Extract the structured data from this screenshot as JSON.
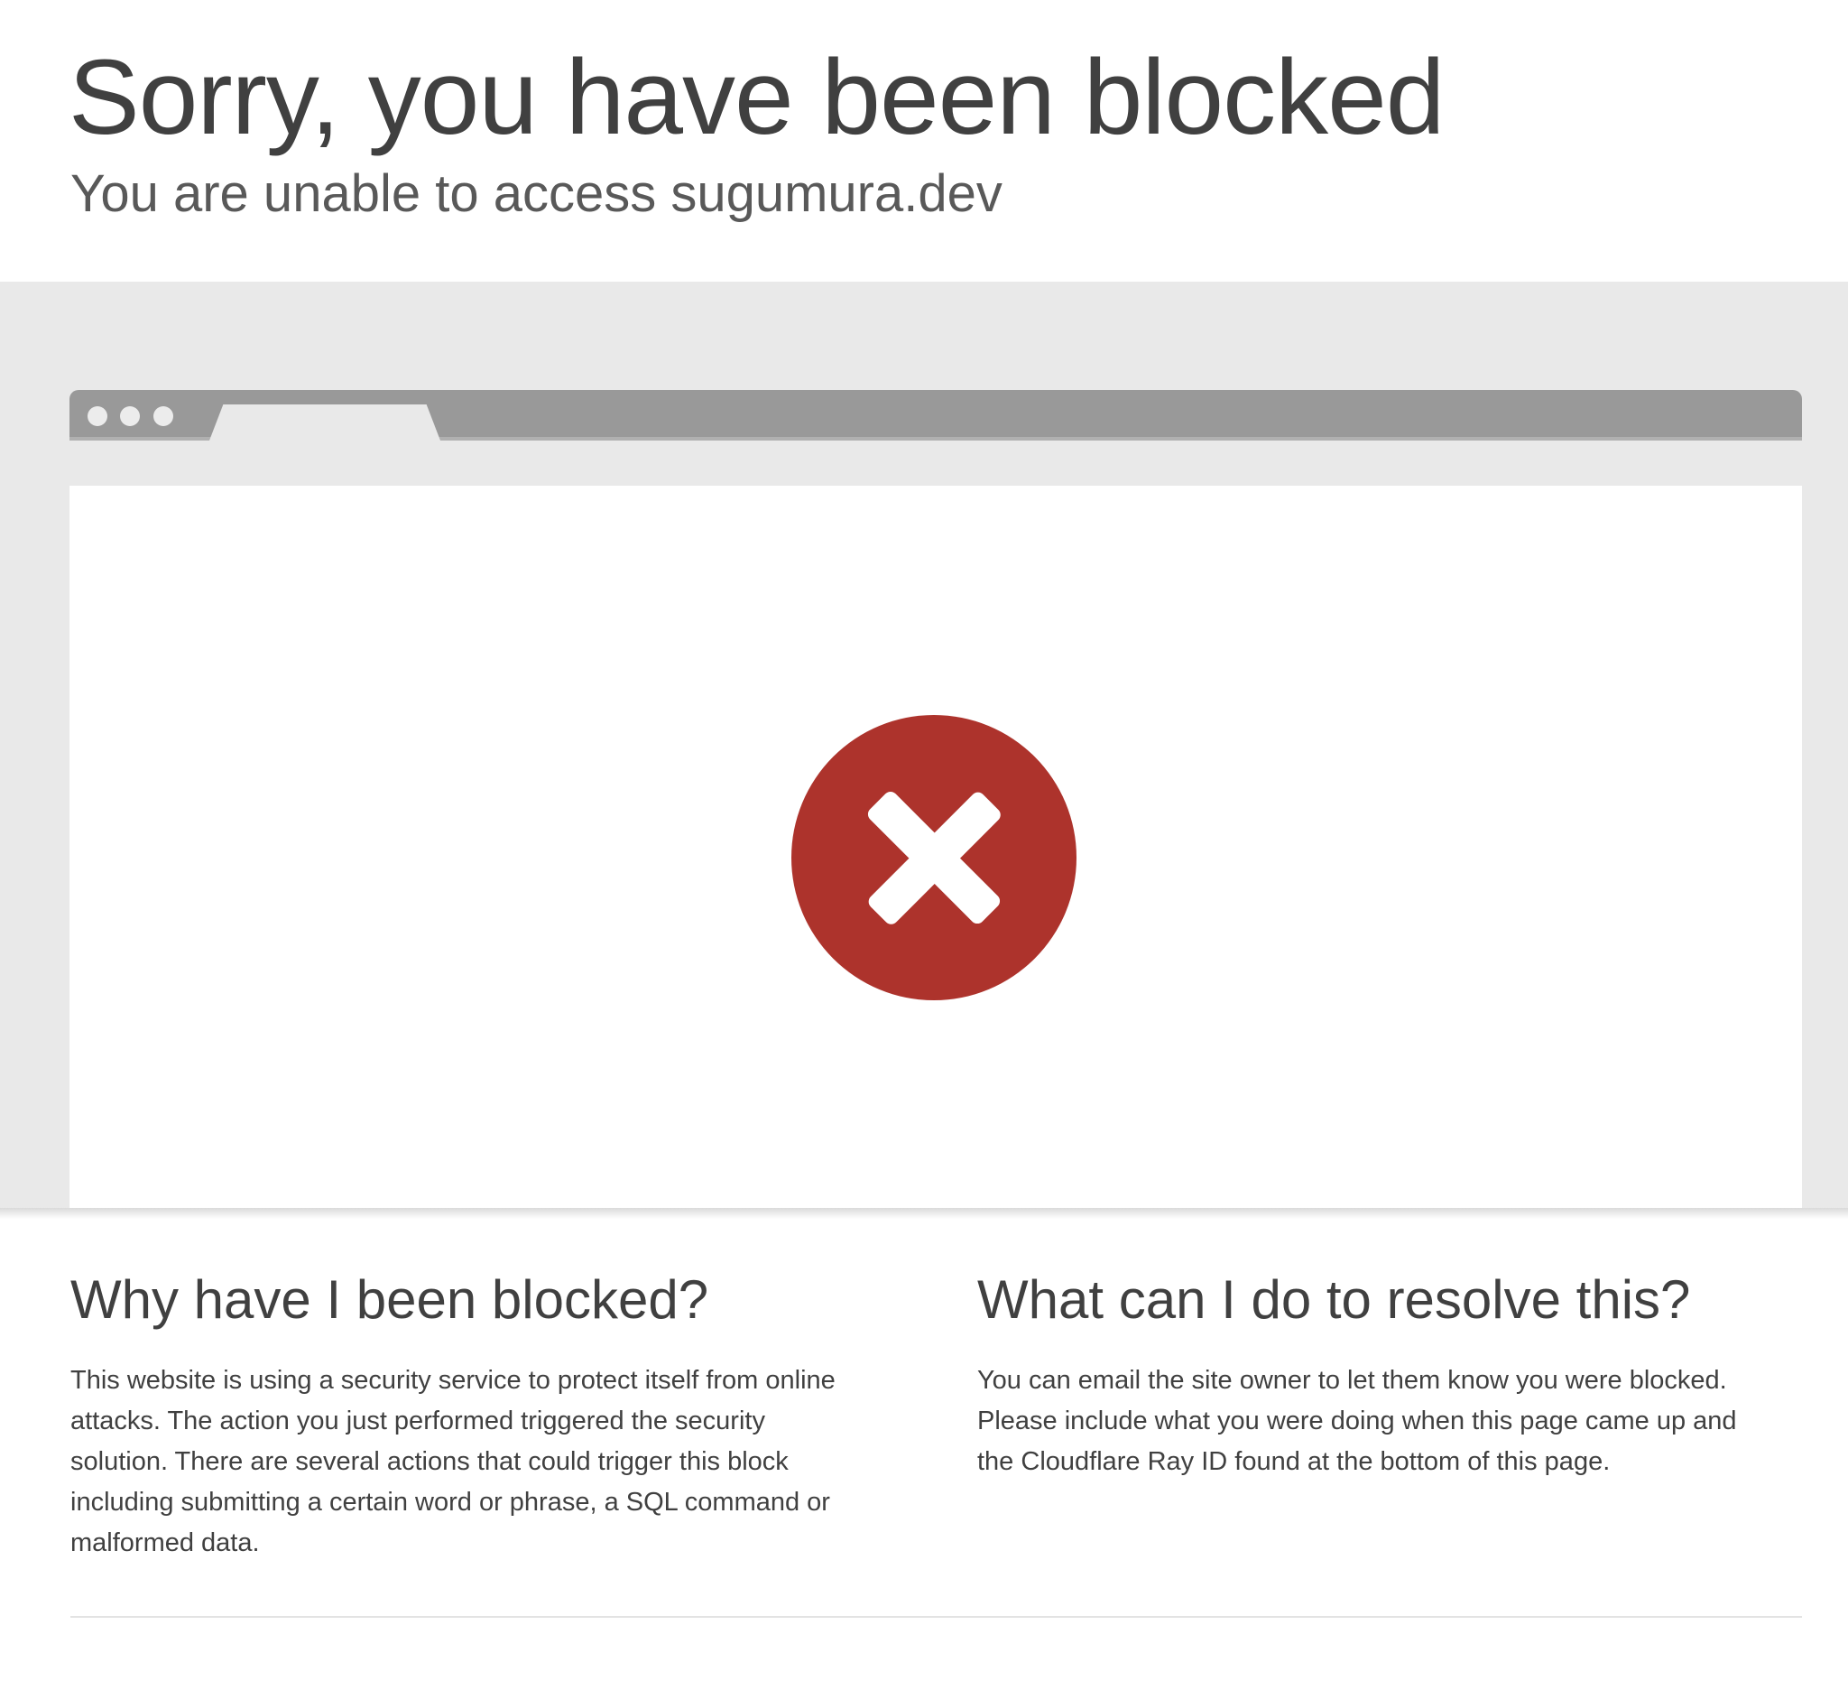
{
  "header": {
    "title": "Sorry, you have been blocked",
    "subtitle": "You are unable to access sugumura.dev"
  },
  "colors": {
    "band_background": "#e9e9e9",
    "browser_bar": "#999999",
    "error_red": "#ad332c",
    "text": "#404040"
  },
  "illustration": {
    "window_dots": 3,
    "status_icon": "error-x-icon"
  },
  "why_blocked": {
    "heading": "Why have I been blocked?",
    "lines": [
      "This website is using a security service to protect itself from online",
      "attacks. The action you just performed triggered the security",
      "solution. There are several actions that could trigger this block",
      "including submitting a certain word or phrase, a SQL command or",
      "malformed data."
    ]
  },
  "resolve": {
    "heading": "What can I do to resolve this?",
    "lines": [
      "You can email the site owner to let them know you were blocked.",
      "Please include what you were doing when this page came up and",
      "the Cloudflare Ray ID found at the bottom of this page."
    ]
  }
}
